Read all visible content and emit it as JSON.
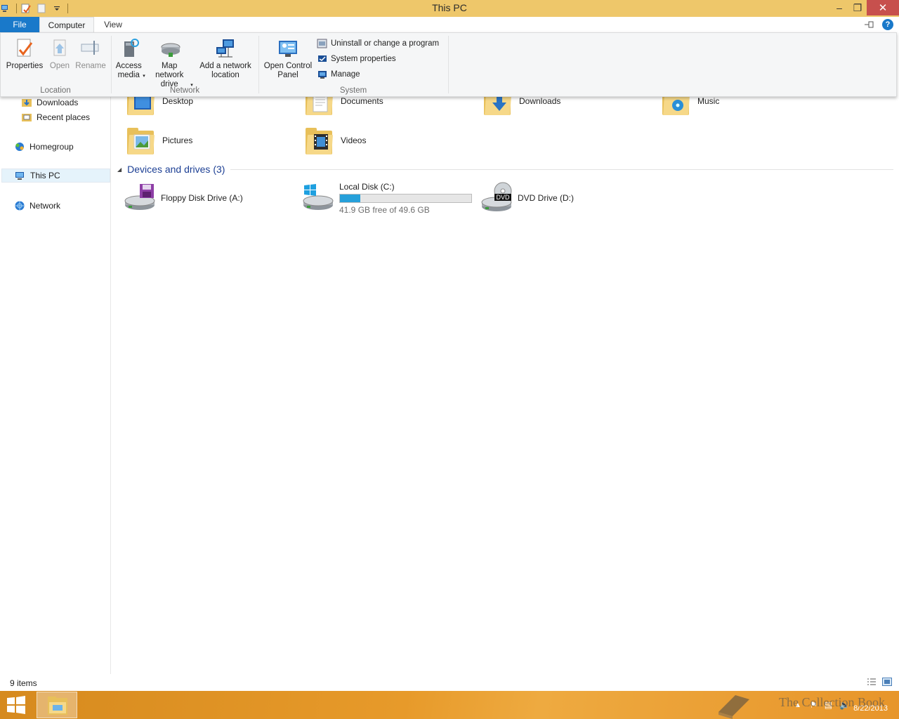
{
  "window": {
    "title": "This PC",
    "minimize_glyph": "–",
    "maximize_glyph": "❐",
    "close_glyph": "✕"
  },
  "ribbon_tabs": {
    "file": "File",
    "computer": "Computer",
    "view": "View"
  },
  "ribbon": {
    "location": {
      "label": "Location",
      "properties": "Properties",
      "open": "Open",
      "rename": "Rename"
    },
    "network": {
      "label": "Network",
      "access_media": "Access media",
      "map_network_drive": "Map network drive",
      "add_network_location": "Add a network location"
    },
    "system": {
      "label": "System",
      "open_control_panel": "Open Control Panel",
      "uninstall": "Uninstall or change a program",
      "system_properties": "System properties",
      "manage": "Manage"
    }
  },
  "nav": {
    "downloads": "Downloads",
    "recent_places": "Recent places",
    "homegroup": "Homegroup",
    "this_pc": "This PC",
    "network": "Network"
  },
  "folders": [
    {
      "name": "Desktop"
    },
    {
      "name": "Documents"
    },
    {
      "name": "Downloads"
    },
    {
      "name": "Music"
    },
    {
      "name": "Pictures"
    },
    {
      "name": "Videos"
    }
  ],
  "devices": {
    "header": "Devices and drives (3)",
    "floppy": "Floppy Disk Drive (A:)",
    "local_disk": "Local Disk (C:)",
    "local_disk_free": "41.9 GB free of 49.6 GB",
    "local_disk_used_fraction": 0.155,
    "dvd": "DVD Drive (D:)",
    "dvd_badge": "DVD"
  },
  "status": {
    "count": "9 items"
  },
  "taskbar": {
    "date": "8/22/2013"
  },
  "watermark": "The Collection Book",
  "colors": {
    "titlebar": "#eec76a",
    "file_tab": "#1979ca",
    "accent": "#26a0da",
    "taskbar": "#e79a2a"
  }
}
